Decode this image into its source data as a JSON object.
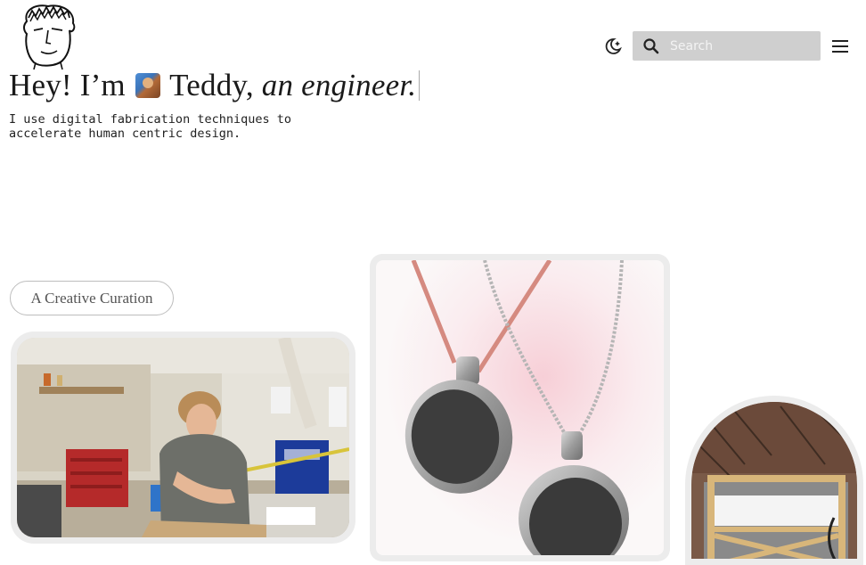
{
  "header": {
    "search": {
      "placeholder": "Search",
      "icon": "search-icon"
    },
    "theme_toggle_icon": "moon-stars-icon",
    "menu_icon": "hamburger-menu-icon",
    "logo_icon": "face-sketch-logo"
  },
  "hero": {
    "greeting": "Hey! I’m",
    "name": "Teddy,",
    "role": "an engineer."
  },
  "intro": {
    "text": "I use digital fabrication techniques to accelerate human centric design."
  },
  "curation": {
    "pill_label": "A Creative Curation"
  },
  "colors": {
    "search_bg": "#cfcfcf",
    "card_bg": "#ececec"
  }
}
